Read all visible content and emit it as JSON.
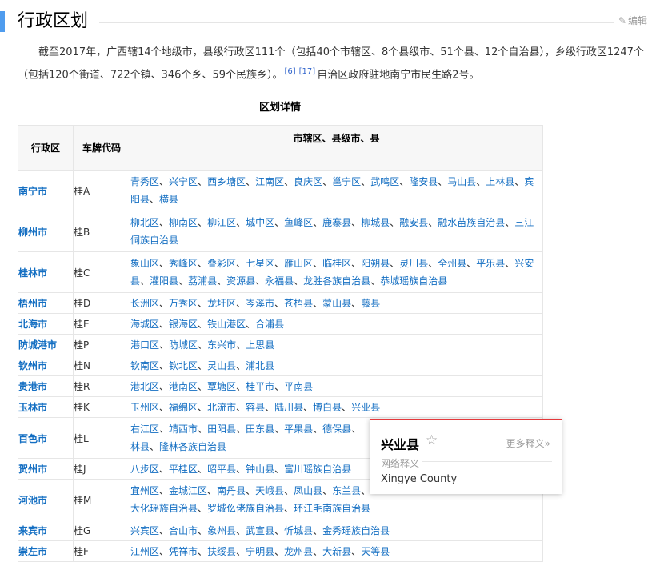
{
  "section": {
    "title": "行政区划",
    "edit_label": "编辑"
  },
  "intro": {
    "text": "截至2017年，广西辖14个地级市，县级行政区111个（包括40个市辖区、8个县级市、51个县、12个自治县），乡级行政区1247个（包括120个街道、722个镇、346个乡、59个民族乡）。",
    "ref1": "[6]",
    "ref2": "[17]",
    "tail": "自治区政府驻地南宁市民生路2号。"
  },
  "table": {
    "caption": "区划详情",
    "headers": [
      "行政区",
      "车牌代码",
      "市辖区、县级市、县"
    ],
    "rows": [
      {
        "city": "南宁市",
        "plate": "桂A",
        "items": [
          "青秀区",
          "兴宁区",
          "西乡塘区",
          "江南区",
          "良庆区",
          "邕宁区",
          "武鸣区",
          "隆安县",
          "马山县",
          "上林县",
          "宾阳县",
          "横县"
        ]
      },
      {
        "city": "柳州市",
        "plate": "桂B",
        "items": [
          "柳北区",
          "柳南区",
          "柳江区",
          "城中区",
          "鱼峰区",
          "鹿寨县",
          "柳城县",
          "融安县",
          "融水苗族自治县",
          "三江侗族自治县"
        ]
      },
      {
        "city": "桂林市",
        "plate": "桂C",
        "items": [
          "象山区",
          "秀峰区",
          "叠彩区",
          "七星区",
          "雁山区",
          "临桂区",
          "阳朔县",
          "灵川县",
          "全州县",
          "平乐县",
          "兴安县",
          "灌阳县",
          "荔浦县",
          "资源县",
          "永福县",
          "龙胜各族自治县",
          "恭城瑶族自治县"
        ]
      },
      {
        "city": "梧州市",
        "plate": "桂D",
        "items": [
          "长洲区",
          "万秀区",
          "龙圩区",
          "岑溪市",
          "苍梧县",
          "蒙山县",
          "藤县"
        ]
      },
      {
        "city": "北海市",
        "plate": "桂E",
        "items": [
          "海城区",
          "银海区",
          "铁山港区",
          "合浦县"
        ]
      },
      {
        "city": "防城港市",
        "plate": "桂P",
        "items": [
          "港口区",
          "防城区",
          "东兴市",
          "上思县"
        ]
      },
      {
        "city": "钦州市",
        "plate": "桂N",
        "items": [
          "钦南区",
          "钦北区",
          "灵山县",
          "浦北县"
        ]
      },
      {
        "city": "贵港市",
        "plate": "桂R",
        "items": [
          "港北区",
          "港南区",
          "覃塘区",
          "桂平市",
          "平南县"
        ]
      },
      {
        "city": "玉林市",
        "plate": "桂K",
        "items": [
          "玉州区",
          "福绵区",
          "北流市",
          "容县",
          "陆川县",
          "博白县",
          "兴业县"
        ]
      },
      {
        "city": "百色市",
        "plate": "桂L",
        "items": [
          "右江区",
          "靖西市",
          "田阳县",
          "田东县",
          "平果县",
          "德保县",
          "",
          "林县",
          "隆林各族自治县"
        ]
      },
      {
        "city": "贺州市",
        "plate": "桂J",
        "items": [
          "八步区",
          "平桂区",
          "昭平县",
          "钟山县",
          "富川瑶族自治县"
        ]
      },
      {
        "city": "河池市",
        "plate": "桂M",
        "items": [
          "宜州区",
          "金城江区",
          "南丹县",
          "天峨县",
          "凤山县",
          "东兰县",
          "",
          "大化瑶族自治县",
          "罗城仫佬族自治县",
          "环江毛南族自治县"
        ]
      },
      {
        "city": "来宾市",
        "plate": "桂G",
        "items": [
          "兴宾区",
          "合山市",
          "象州县",
          "武宣县",
          "忻城县",
          "金秀瑶族自治县"
        ]
      },
      {
        "city": "崇左市",
        "plate": "桂F",
        "items": [
          "江州区",
          "凭祥市",
          "扶绥县",
          "宁明县",
          "龙州县",
          "大新县",
          "天等县"
        ]
      }
    ]
  },
  "popup": {
    "word": "兴业县",
    "more": "更多释义»",
    "subtitle": "网络释义",
    "definition": "Xingye County"
  },
  "colors": {
    "link": "#136ec2",
    "accent": "#4f9cee",
    "popup_border": "#e4393c"
  },
  "icons": [
    "pencil-icon",
    "star-icon"
  ]
}
